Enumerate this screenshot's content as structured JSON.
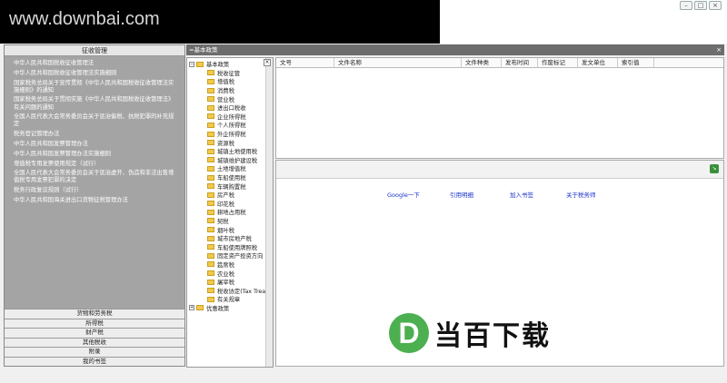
{
  "watermark": "www.downbai.com",
  "window_buttons": [
    "–",
    "□",
    "×"
  ],
  "left_nav": {
    "header": "征收管理",
    "links": [
      "中华人民共和国税收征收管理法",
      "中华人民共和国税收征收管理法实施细则",
      "国家税务总局关于宣传贯彻《中华人民共和国税收征收管理法实施细则》的通知",
      "国家税务总局关于贯彻实施《中华人民共和国税收征收管理法》有关问题的通知",
      "全国人民代表大会常务委员会关于惩治偷税、抗税犯罪的补充规定",
      "税务登记管理办法",
      "中华人民共和国发票管理办法",
      "中华人民共和国发票管理办法实施细则",
      "增值税专用发票使用规定（试行）",
      "全国人民代表大会常务委员会关于惩治虚开、伪造和非法出售增值税专用发票犯罪的决定",
      "税务行政复议规则（试行）",
      "中华人民共和国海关进出口货物征税管理办法"
    ],
    "bottom_buttons": [
      "货物和劳务税",
      "所得税",
      "财产税",
      "其他税收",
      "附录",
      "我的书签"
    ]
  },
  "main": {
    "header": "=基本政策",
    "close": "×",
    "columns": [
      "文号",
      "文件名称",
      "文件种类",
      "发布时间",
      "作废标记",
      "发文单位",
      "索引值"
    ]
  },
  "tree": {
    "root": "基本政策",
    "items": [
      "税收征管",
      "增值税",
      "消费税",
      "营业税",
      "进出口税收",
      "企业所得税",
      "个人所得税",
      "外企所得税",
      "资源税",
      "城镇土地使用税",
      "城镇维护建设税",
      "土地增值税",
      "车船使用税",
      "车辆购置税",
      "房产税",
      "印花税",
      "耕地占用税",
      "契税",
      "烟叶税",
      "城市房地产税",
      "车船使用牌照税",
      "固定资产投资方向",
      "筵席税",
      "农业税",
      "屠宰税",
      "税收协定(Tax Trea",
      "有关规章"
    ],
    "second_root": "优惠政策"
  },
  "bottom_links": [
    "Google一下",
    "引用明细",
    "加入书签",
    "关于税务师"
  ],
  "logo": {
    "mark": "D",
    "text": "当百下载",
    "color": "#4caf50"
  }
}
